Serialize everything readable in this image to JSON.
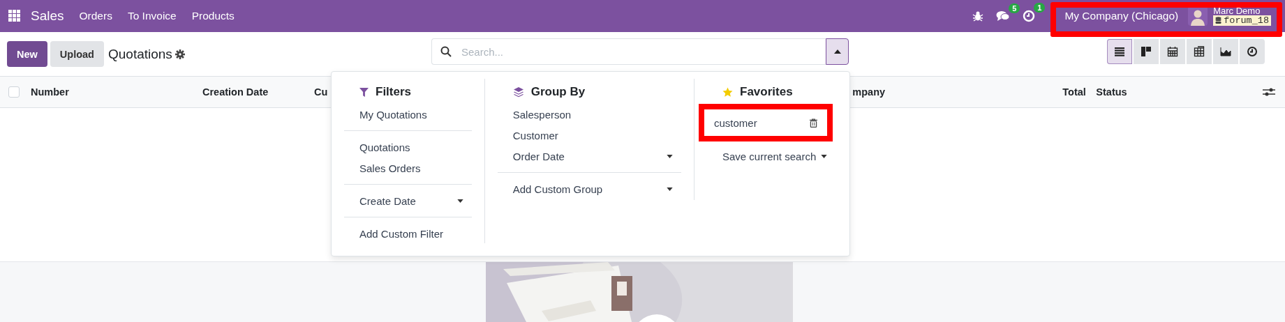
{
  "navbar": {
    "app": "Sales",
    "menu": [
      "Orders",
      "To Invoice",
      "Products"
    ],
    "systray": [
      {
        "kind": "bug"
      },
      {
        "kind": "chat",
        "count": "5"
      },
      {
        "kind": "activity",
        "count": "1"
      }
    ],
    "company": "My Company (Chicago)",
    "user": {
      "name": "Marc Demo",
      "database": "forum_18",
      "highlighted": true
    }
  },
  "control_panel": {
    "buttons": [
      {
        "label": "New",
        "kind": "primary"
      },
      {
        "label": "Upload",
        "kind": "secondary"
      }
    ],
    "title": "Quotations",
    "search": {
      "placeholder": "Search...",
      "panel_open": true
    },
    "views": [
      {
        "kind": "list",
        "selected": true
      },
      {
        "kind": "kanban",
        "selected": false
      },
      {
        "kind": "calendar",
        "selected": false
      },
      {
        "kind": "pivot",
        "selected": false
      },
      {
        "kind": "graph",
        "selected": false
      },
      {
        "kind": "activity",
        "selected": false
      }
    ]
  },
  "list": {
    "select_all_checked": false,
    "columns": [
      "Number",
      "Creation Date",
      "Cu",
      "mpany",
      "Total",
      "Status"
    ]
  },
  "search_panel": {
    "filters": {
      "title": "Filters",
      "groups": [
        [
          {
            "label": "My Quotations",
            "kind": "option"
          }
        ],
        [
          {
            "label": "Quotations",
            "kind": "option"
          },
          {
            "label": "Sales Orders",
            "kind": "option"
          }
        ],
        [
          {
            "label": "Create Date",
            "kind": "dropdown"
          }
        ],
        [
          {
            "label": "Add Custom Filter",
            "kind": "option"
          }
        ]
      ]
    },
    "group_by": {
      "title": "Group By",
      "groups": [
        [
          {
            "label": "Salesperson",
            "kind": "option"
          },
          {
            "label": "Customer",
            "kind": "option"
          },
          {
            "label": "Order Date",
            "kind": "dropdown"
          }
        ],
        [
          {
            "label": "Add Custom Group",
            "kind": "dropdown"
          }
        ]
      ]
    },
    "favorites": {
      "title": "Favorites",
      "items": [
        {
          "label": "customer",
          "kind": "saved",
          "highlighted": true
        },
        {
          "label": "Save current search",
          "kind": "dropdown",
          "highlighted": false
        }
      ]
    }
  }
}
